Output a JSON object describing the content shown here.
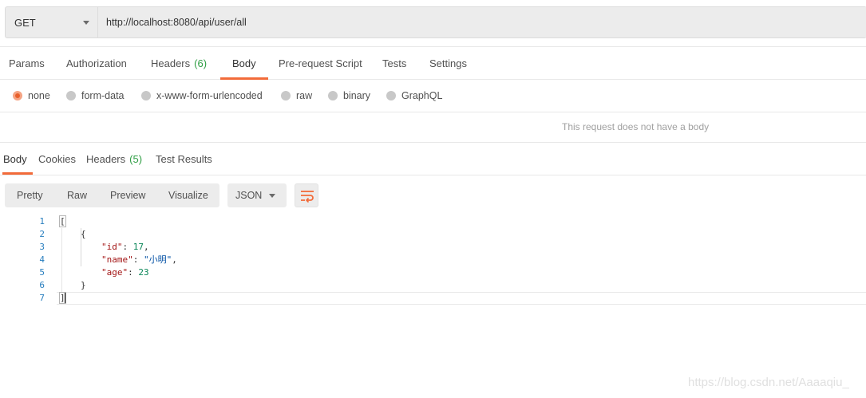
{
  "request": {
    "method": "GET",
    "url": "http://localhost:8080/api/user/all"
  },
  "request_tabs": [
    {
      "label": "Params",
      "count": null
    },
    {
      "label": "Authorization",
      "count": null
    },
    {
      "label": "Headers",
      "count": "(6)"
    },
    {
      "label": "Body",
      "count": null,
      "active": true
    },
    {
      "label": "Pre-request Script",
      "count": null
    },
    {
      "label": "Tests",
      "count": null
    },
    {
      "label": "Settings",
      "count": null
    }
  ],
  "body_types": [
    {
      "label": "none",
      "selected": true
    },
    {
      "label": "form-data"
    },
    {
      "label": "x-www-form-urlencoded"
    },
    {
      "label": "raw"
    },
    {
      "label": "binary"
    },
    {
      "label": "GraphQL"
    }
  ],
  "no_body_message": "This request does not have a body",
  "response_tabs": [
    {
      "label": "Body",
      "active": true
    },
    {
      "label": "Cookies"
    },
    {
      "label": "Headers",
      "count": "(5)"
    },
    {
      "label": "Test Results"
    }
  ],
  "view_modes": [
    "Pretty",
    "Raw",
    "Preview",
    "Visualize"
  ],
  "format": "JSON",
  "wrap_icon": "wrap-lines-icon",
  "code_lines": [
    "1",
    "2",
    "3",
    "4",
    "5",
    "6",
    "7"
  ],
  "response_json": {
    "open_array": "[",
    "open_obj": "{",
    "id_key": "\"id\"",
    "id_val": "17",
    "name_key": "\"name\"",
    "name_val": "\"小明\"",
    "age_key": "\"age\"",
    "age_val": "23",
    "close_obj": "}",
    "close_array": "]"
  },
  "watermark": "https://blog.csdn.net/Aaaaqiu_",
  "colors": {
    "accent": "#f26b3a",
    "count_green": "#2f9e44"
  }
}
